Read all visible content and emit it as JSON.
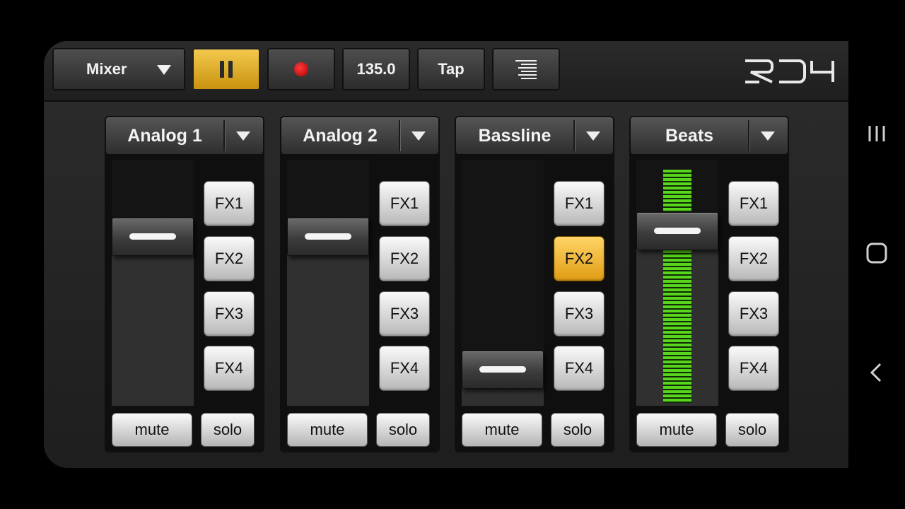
{
  "toolbar": {
    "view_select": "Mixer",
    "tempo": "135.0",
    "tap_label": "Tap",
    "icons": {
      "pause": "pause-icon",
      "record": "record-icon",
      "menu": "menu-icon"
    },
    "pause_active": true,
    "record_color": "#e01010"
  },
  "logo_text": "RD4",
  "accent_color": "#f0b92a",
  "meter_color": "#58d51c",
  "channels": [
    {
      "name": "Analog 1",
      "fx": [
        "FX1",
        "FX2",
        "FX3",
        "FX4"
      ],
      "fx_active": [],
      "mute": "mute",
      "solo": "solo",
      "fader_level": 0.72,
      "meter_level": 0.0
    },
    {
      "name": "Analog 2",
      "fx": [
        "FX1",
        "FX2",
        "FX3",
        "FX4"
      ],
      "fx_active": [],
      "mute": "mute",
      "solo": "solo",
      "fader_level": 0.72,
      "meter_level": 0.0
    },
    {
      "name": "Bassline",
      "fx": [
        "FX1",
        "FX2",
        "FX3",
        "FX4"
      ],
      "fx_active": [
        "FX2"
      ],
      "mute": "mute",
      "solo": "solo",
      "fader_level": 0.08,
      "meter_level": 0.0
    },
    {
      "name": "Beats",
      "fx": [
        "FX1",
        "FX2",
        "FX3",
        "FX4"
      ],
      "fx_active": [],
      "mute": "mute",
      "solo": "solo",
      "fader_level": 0.75,
      "meter_level": 0.97
    }
  ],
  "navbar": {
    "recents": "recents-icon",
    "home": "home-icon",
    "back": "back-icon"
  }
}
